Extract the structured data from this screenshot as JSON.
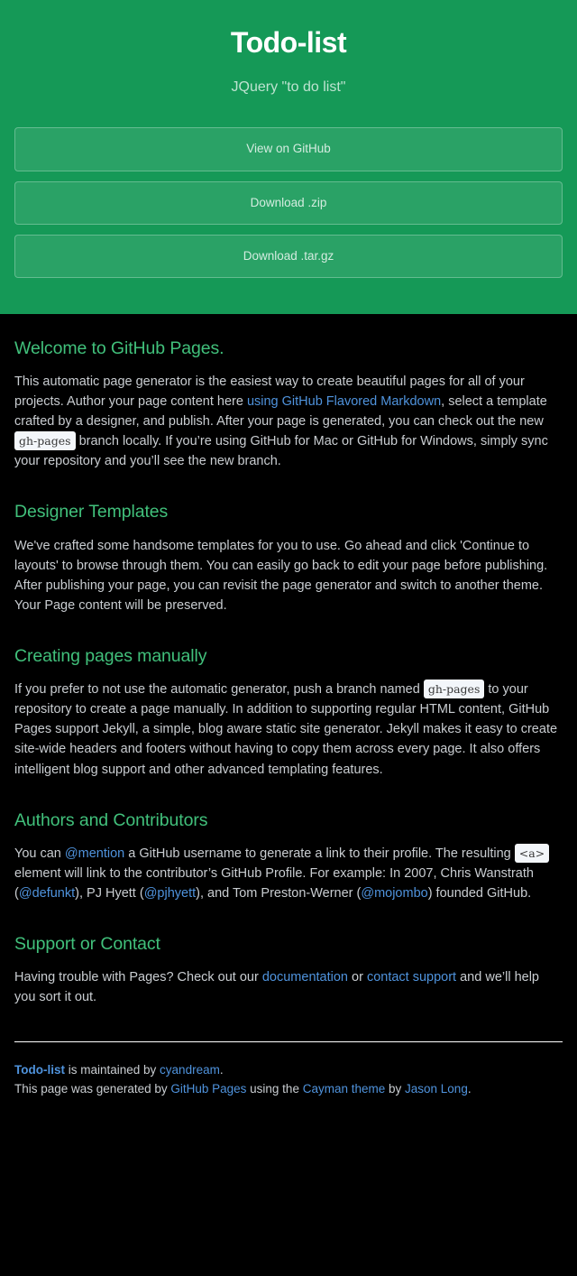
{
  "header": {
    "project_name": "Todo-list",
    "tagline": "JQuery \"to do list\"",
    "buttons": [
      {
        "label": "View on GitHub",
        "name": "view-on-github-button"
      },
      {
        "label": "Download .zip",
        "name": "download-zip-button"
      },
      {
        "label": "Download .tar.gz",
        "name": "download-targz-button"
      }
    ]
  },
  "colors": {
    "header_background": "#159957",
    "page_background": "#000000",
    "heading": "#41c07b",
    "link": "#4f93dd",
    "body_text": "#c9cdd1",
    "code_background": "#f3f6fa",
    "code_text": "#383838",
    "button_text": "rgba(255,255,255,0.80)"
  },
  "sections": {
    "welcome": {
      "heading": "Welcome to GitHub Pages.",
      "p1_a": "This automatic page generator is the easiest way to create beautiful pages for all of your projects. Author your page content here ",
      "p1_link": "using GitHub Flavored Markdown",
      "p1_b": ", select a template crafted by a designer, and publish. After your page is generated, you can check out the new ",
      "p1_code": "gh-pages",
      "p1_c": " branch locally. If you’re using GitHub for Mac or GitHub for Windows, simply sync your repository and you’ll see the new branch."
    },
    "designer_templates": {
      "heading": "Designer Templates",
      "paragraph": "We've crafted some handsome templates for you to use. Go ahead and click 'Continue to layouts' to browse through them. You can easily go back to edit your page before publishing. After publishing your page, you can revisit the page generator and switch to another theme. Your Page content will be preserved."
    },
    "creating_pages": {
      "heading": "Creating pages manually",
      "p1_a": "If you prefer to not use the automatic generator, push a branch named ",
      "p1_code": "gh-pages",
      "p1_b": " to your repository to create a page manually. In addition to supporting regular HTML content, GitHub Pages support Jekyll, a simple, blog aware static site generator. Jekyll makes it easy to create site-wide headers and footers without having to copy them across every page. It also offers intelligent blog support and other advanced templating features."
    },
    "authors": {
      "heading": "Authors and Contributors",
      "p1_a": "You can ",
      "p1_link_mention": "@mention",
      "p1_b": " a GitHub username to generate a link to their profile. The resulting ",
      "p1_code": "<a>",
      "p1_c": " element will link to the contributor’s GitHub Profile. For example: In 2007, Chris Wanstrath (",
      "p1_link_defunkt": "@defunkt",
      "p1_d": "), PJ Hyett (",
      "p1_link_pjhyett": "@pjhyett",
      "p1_e": "), and Tom Preston-Werner (",
      "p1_link_mojombo": "@mojombo",
      "p1_f": ") founded GitHub."
    },
    "support": {
      "heading": "Support or Contact",
      "p1_a": "Having trouble with Pages? Check out our ",
      "p1_link_docs": "documentation",
      "p1_b": " or ",
      "p1_link_contact": "contact support",
      "p1_c": " and we’ll help you sort it out."
    }
  },
  "footer": {
    "owner_project": "Todo-list",
    "owner_mid": " is maintained by ",
    "owner_name": "cyandream",
    "owner_end": ".",
    "credits_a": "This page was generated by ",
    "credits_link_pages": "GitHub Pages",
    "credits_b": " using the ",
    "credits_link_theme": "Cayman theme",
    "credits_c": " by ",
    "credits_link_author": "Jason Long",
    "credits_d": "."
  }
}
